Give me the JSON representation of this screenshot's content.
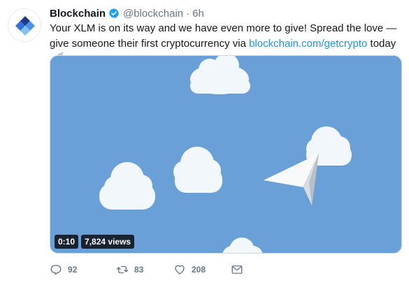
{
  "tweet": {
    "author_name": "Blockchain",
    "handle": "@blockchain",
    "separator": "·",
    "time": "6h",
    "text_part1": "Your XLM is on its way and we have even more to give! Spread the love — give someone their first cryptocurrency via ",
    "link": "blockchain.com/getcrypto",
    "text_part2": " today"
  },
  "media": {
    "duration": "0:10",
    "views": "7,824 views"
  },
  "actions": {
    "replies": "92",
    "retweets": "83",
    "likes": "208"
  },
  "icons": {
    "avatar": "blockchain-logo-icon",
    "verified": "verified-badge-icon",
    "rocket": "rocket-emoji-icon",
    "reply": "reply-icon",
    "retweet": "retweet-icon",
    "like": "heart-icon",
    "dm": "direct-message-icon"
  },
  "colors": {
    "link": "#1b95e0",
    "secondary_text": "#657786",
    "verified": "#1da1f2",
    "sky": "#6aa0d8"
  }
}
